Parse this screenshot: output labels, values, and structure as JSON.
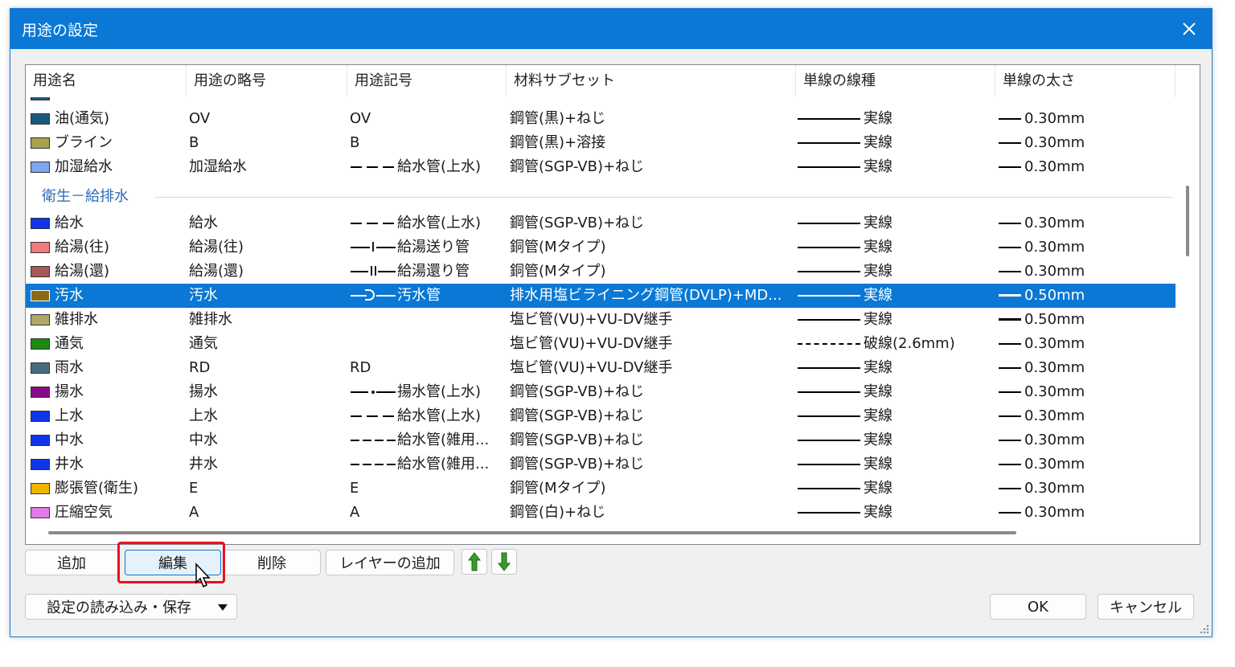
{
  "window": {
    "title": "用途の設定"
  },
  "columns": [
    "用途名",
    "用途の略号",
    "用途記号",
    "材料サブセット",
    "単線の線種",
    "単線の太さ"
  ],
  "rows_top": [
    {
      "name": "油(通気)",
      "abbr": "OV",
      "symbol": "OV",
      "symbol_line": "",
      "material": "鋼管(黒)+ねじ",
      "line_type": "実線",
      "line_style": "solid",
      "width": "0.30mm",
      "color": "#1d5a7a"
    },
    {
      "name": "ブライン",
      "abbr": "B",
      "symbol": "B",
      "symbol_line": "",
      "material": "鋼管(黒)+溶接",
      "line_type": "実線",
      "line_style": "solid",
      "width": "0.30mm",
      "color": "#a8a24e"
    },
    {
      "name": "加湿給水",
      "abbr": "加湿給水",
      "symbol": "給水管(上水)",
      "symbol_line": "dash3",
      "material": "鋼管(SGP-VB)+ねじ",
      "line_type": "実線",
      "line_style": "solid",
      "width": "0.30mm",
      "color": "#7ea6f0"
    }
  ],
  "group_label": "衛生－給排水",
  "rows": [
    {
      "name": "給水",
      "abbr": "給水",
      "symbol": "給水管(上水)",
      "symbol_line": "dash3",
      "material": "鋼管(SGP-VB)+ねじ",
      "line_type": "実線",
      "line_style": "solid",
      "width": "0.30mm",
      "color": "#1034e8",
      "selected": false
    },
    {
      "name": "給湯(往)",
      "abbr": "給湯(往)",
      "symbol": "給湯送り管",
      "symbol_line": "tick1",
      "material": "銅管(Mタイプ)",
      "line_type": "実線",
      "line_style": "solid",
      "width": "0.30mm",
      "color": "#f07a7a",
      "selected": false
    },
    {
      "name": "給湯(還)",
      "abbr": "給湯(還)",
      "symbol": "給湯還り管",
      "symbol_line": "tick2",
      "material": "銅管(Mタイプ)",
      "line_type": "実線",
      "line_style": "solid",
      "width": "0.30mm",
      "color": "#a85858",
      "selected": false
    },
    {
      "name": "汚水",
      "abbr": "汚水",
      "symbol": "汚水管",
      "symbol_line": "arc",
      "material": "排水用塩ビライニング鋼管(DVLP)+MD...",
      "line_type": "実線",
      "line_style": "solid",
      "width": "0.50mm",
      "thick": true,
      "color": "#8a6a18",
      "selected": true
    },
    {
      "name": "雑排水",
      "abbr": "雑排水",
      "symbol": "",
      "symbol_line": "",
      "material": "塩ビ管(VU)+VU-DV継手",
      "line_type": "実線",
      "line_style": "solid",
      "width": "0.50mm",
      "thick": true,
      "color": "#b0a868",
      "selected": false
    },
    {
      "name": "通気",
      "abbr": "通気",
      "symbol": "",
      "symbol_line": "",
      "material": "塩ビ管(VU)+VU-DV継手",
      "line_type": "破線(2.6mm)",
      "line_style": "dash",
      "width": "0.30mm",
      "color": "#1a8a12",
      "selected": false
    },
    {
      "name": "雨水",
      "abbr": "RD",
      "symbol": "RD",
      "symbol_line": "",
      "material": "塩ビ管(VU)+VU-DV継手",
      "line_type": "実線",
      "line_style": "solid",
      "width": "0.30mm",
      "color": "#466c7e",
      "selected": false
    },
    {
      "name": "揚水",
      "abbr": "揚水",
      "symbol": "揚水管(上水)",
      "symbol_line": "dot",
      "material": "鋼管(SGP-VB)+ねじ",
      "line_type": "実線",
      "line_style": "solid",
      "width": "0.30mm",
      "color": "#880a88",
      "selected": false
    },
    {
      "name": "上水",
      "abbr": "上水",
      "symbol": "給水管(上水)",
      "symbol_line": "dash3",
      "material": "鋼管(SGP-VB)+ねじ",
      "line_type": "実線",
      "line_style": "solid",
      "width": "0.30mm",
      "color": "#1034e8",
      "selected": false
    },
    {
      "name": "中水",
      "abbr": "中水",
      "symbol": "給水管(雑用...",
      "symbol_line": "dash4",
      "material": "鋼管(SGP-VB)+ねじ",
      "line_type": "実線",
      "line_style": "solid",
      "width": "0.30mm",
      "color": "#1034e8",
      "selected": false
    },
    {
      "name": "井水",
      "abbr": "井水",
      "symbol": "給水管(雑用...",
      "symbol_line": "dash4",
      "material": "鋼管(SGP-VB)+ねじ",
      "line_type": "実線",
      "line_style": "solid",
      "width": "0.30mm",
      "color": "#1034e8",
      "selected": false
    },
    {
      "name": "膨張管(衛生)",
      "abbr": "E",
      "symbol": "E",
      "symbol_line": "",
      "material": "銅管(Mタイプ)",
      "line_type": "実線",
      "line_style": "solid",
      "width": "0.30mm",
      "color": "#f0b400",
      "selected": false
    },
    {
      "name": "圧縮空気",
      "abbr": "A",
      "symbol": "A",
      "symbol_line": "",
      "material": "鋼管(白)+ねじ",
      "line_type": "実線",
      "line_style": "solid",
      "width": "0.30mm",
      "color": "#e07ae8",
      "selected": false
    }
  ],
  "buttons": {
    "add": "追加",
    "edit": "編集",
    "delete": "削除",
    "add_layer": "レイヤーの追加",
    "load_save": "設定の読み込み・保存",
    "ok": "OK",
    "cancel": "キャンセル"
  },
  "colors": {
    "accent": "#0a78d4",
    "highlight_box": "#e81123",
    "arrow_green": "#3a9a2a"
  }
}
